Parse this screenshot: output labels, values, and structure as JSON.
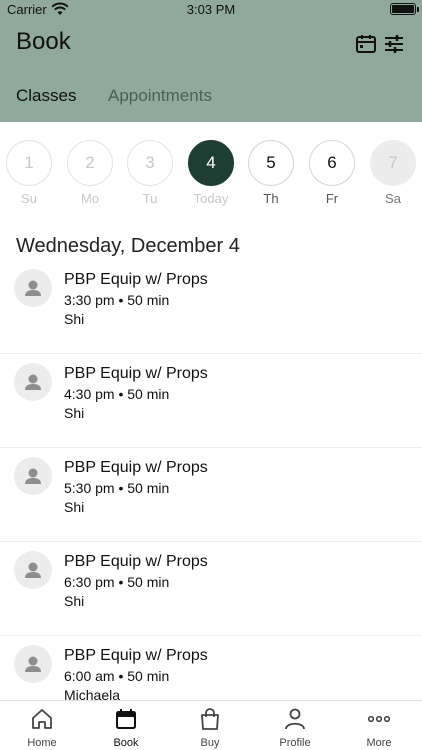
{
  "status_bar": {
    "carrier": "Carrier",
    "time": "3:03 PM"
  },
  "header": {
    "title": "Book",
    "tabs": [
      {
        "label": "Classes",
        "selected": true
      },
      {
        "label": "Appointments",
        "selected": false
      }
    ],
    "icons": [
      "calendar-icon",
      "filter-sliders-icon"
    ]
  },
  "days": [
    {
      "number": "1",
      "label": "Su",
      "state": "past"
    },
    {
      "number": "2",
      "label": "Mo",
      "state": "past"
    },
    {
      "number": "3",
      "label": "Tu",
      "state": "past"
    },
    {
      "number": "4",
      "label": "Today",
      "state": "selected"
    },
    {
      "number": "5",
      "label": "Th",
      "state": "future"
    },
    {
      "number": "6",
      "label": "Fr",
      "state": "future"
    },
    {
      "number": "7",
      "label": "Sa",
      "state": "disabled"
    }
  ],
  "date_heading": "Wednesday, December 4",
  "classes": [
    {
      "name": "PBP Equip w/ Props",
      "meta": "3:30 pm • 50 min",
      "instructor": "Shi"
    },
    {
      "name": "PBP Equip w/ Props",
      "meta": "4:30 pm • 50 min",
      "instructor": "Shi"
    },
    {
      "name": "PBP Equip w/ Props",
      "meta": "5:30 pm • 50 min",
      "instructor": "Shi"
    },
    {
      "name": "PBP Equip w/ Props",
      "meta": "6:30 pm • 50 min",
      "instructor": "Shi"
    },
    {
      "name": "PBP Equip w/ Props",
      "meta": "6:00 am • 50 min",
      "instructor": "Michaela"
    }
  ],
  "tab_bar": [
    {
      "label": "Home",
      "icon": "home-icon"
    },
    {
      "label": "Book",
      "icon": "calendar-icon",
      "active": true
    },
    {
      "label": "Buy",
      "icon": "shopping-bag-icon"
    },
    {
      "label": "Profile",
      "icon": "person-icon"
    },
    {
      "label": "More",
      "icon": "more-dots-icon"
    }
  ],
  "colors": {
    "header_bg": "#8fa99d",
    "accent": "#1e3d33"
  }
}
